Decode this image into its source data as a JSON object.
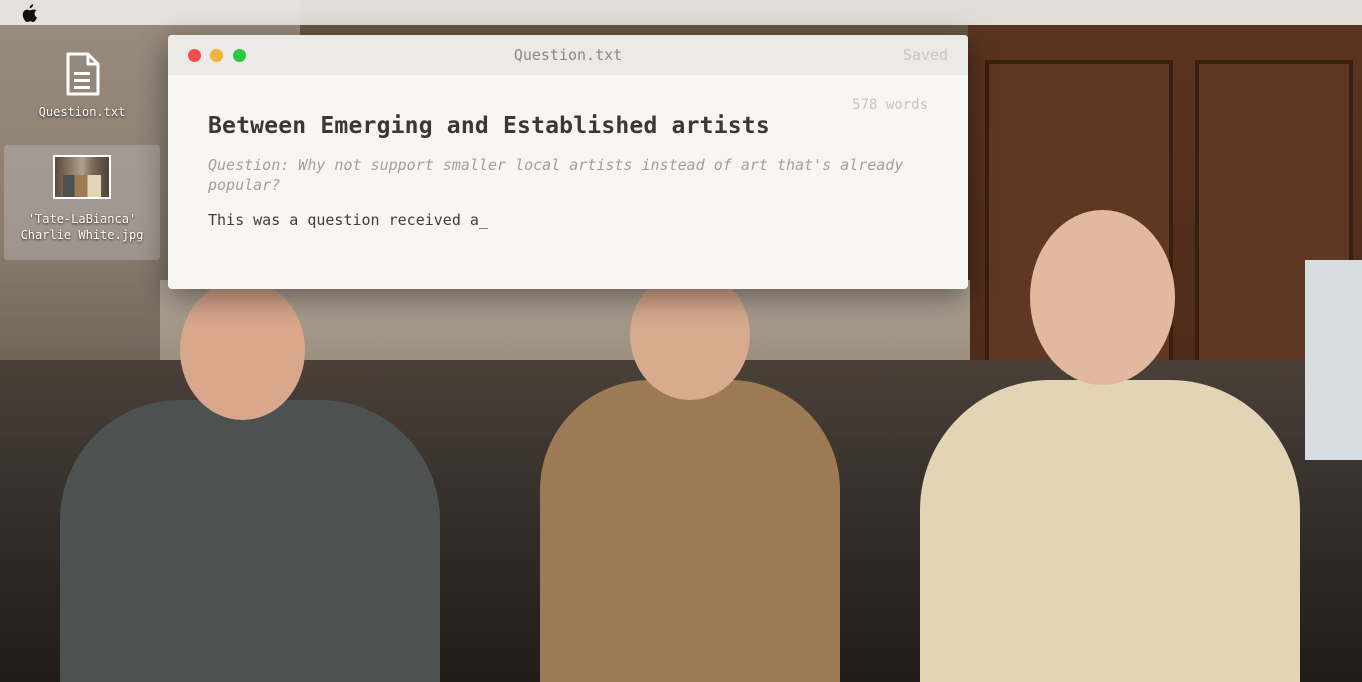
{
  "desktop_icons": [
    {
      "label": "Question.txt",
      "icon": "text-file-icon"
    },
    {
      "label": "'Tate-LaBianca' Charlie White.jpg",
      "icon": "image-thumbnail"
    }
  ],
  "window": {
    "title": "Question.txt",
    "save_status": "Saved",
    "word_count": "578 words"
  },
  "document": {
    "title": "Between Emerging and Established artists",
    "question": "Question: Why not support smaller local artists instead of art that's already popular?",
    "body": "This was a question received a",
    "cursor": "_"
  },
  "colors": {
    "close": "#f0504d",
    "minimize": "#f2b23c",
    "maximize": "#2bc840"
  }
}
